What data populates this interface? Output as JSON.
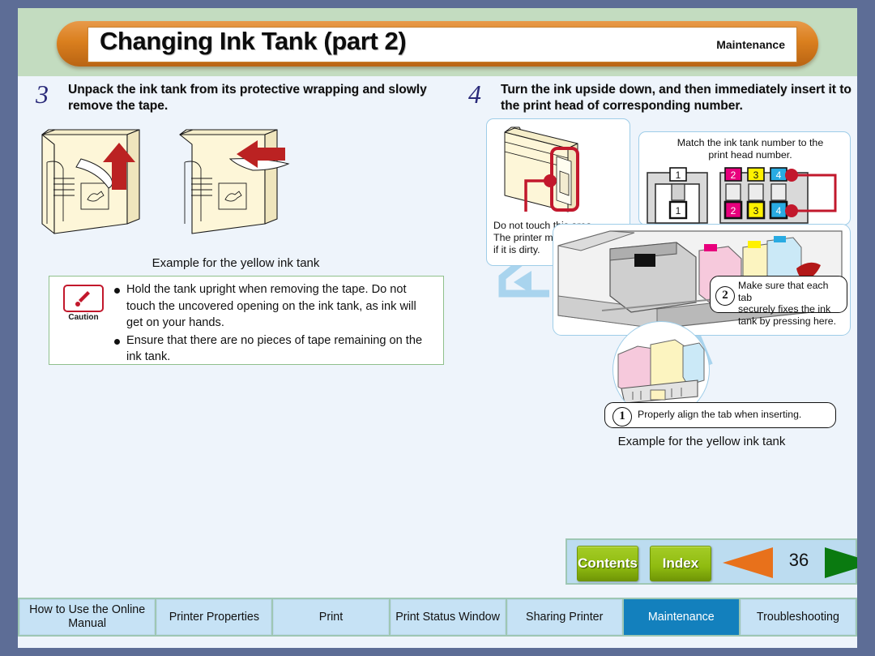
{
  "header": {
    "title": "Changing Ink Tank (part 2)",
    "section": "Maintenance"
  },
  "steps": [
    {
      "number": "3",
      "text": "Unpack the ink tank from its protective wrapping and slowly remove the tape.",
      "caption": "Example for the yellow ink tank"
    },
    {
      "number": "4",
      "text": "Turn the ink upside down, and then immediately insert it to the print head of corresponding number.",
      "caption": "Example for the yellow ink tank"
    }
  ],
  "caution": {
    "label": "Caution",
    "icon": "caution-exclamation-icon",
    "items": [
      "Hold the tank upright when removing the tape. Do not touch the uncovered opening on the ink tank, as ink will get on your hands.",
      "Ensure that there are no pieces of tape remaining on the ink tank."
    ]
  },
  "notes": {
    "do_not_touch": "Do not touch this area.\nThe printer may not print\nif it is dirty.",
    "do_not_touch_lines": [
      "Do not touch this area.",
      "The printer may not print",
      "if it is dirty."
    ],
    "match_numbers": "Match the ink tank number to the print head number.",
    "match_numbers_lines": [
      "Match the ink tank number to the",
      "print head number."
    ],
    "tank_numbers": [
      "1",
      "2",
      "3",
      "4"
    ],
    "tank_colors": [
      "#ffffff",
      "#e8007d",
      "#fff100",
      "#29abe2"
    ]
  },
  "callouts": [
    {
      "number": "1",
      "text": "Properly align the tab when inserting."
    },
    {
      "number": "2",
      "text": "Make sure that each tab securely fixes the ink tank by pressing here.",
      "lines": [
        "Make sure that each tab",
        "securely fixes the ink",
        "tank by pressing here."
      ]
    }
  ],
  "controls": {
    "contents_label": "Contents",
    "index_label": "Index",
    "prev_icon": "left-arrow-icon",
    "next_icon": "right-arrow-icon",
    "page_number": "36"
  },
  "tabs": [
    {
      "label": "How to Use the Online Manual",
      "active": false
    },
    {
      "label": "Printer Properties",
      "active": false
    },
    {
      "label": "Print",
      "active": false
    },
    {
      "label": "Print Status Window",
      "active": false
    },
    {
      "label": "Sharing Printer",
      "active": false
    },
    {
      "label": "Maintenance",
      "active": true
    },
    {
      "label": "Troubleshooting",
      "active": false
    }
  ],
  "colors": {
    "outer_border": "#5d6d96",
    "page_bg": "#eef4fb",
    "header_band": "#c3dcc0",
    "title_orange": "#da7f1e",
    "accent_blue": "#1380bd",
    "caution_red": "#c2182c",
    "button_green": "#8fbb10",
    "prev_orange": "#e8711b",
    "next_green": "#0a7a10"
  }
}
